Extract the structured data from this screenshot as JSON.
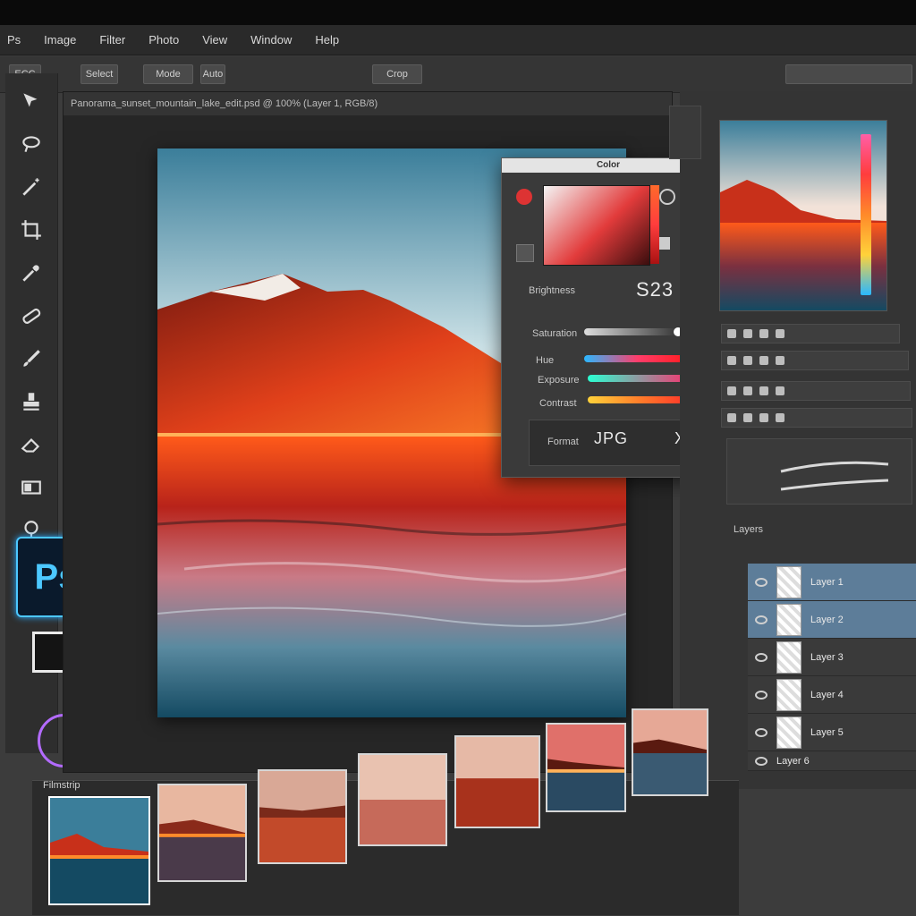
{
  "menu": {
    "items": [
      "Ps",
      "Image",
      "Filter",
      "Photo",
      "View",
      "Window",
      "Help"
    ]
  },
  "options_bar": {
    "buttons": [
      "ECC",
      "Select",
      "Mode",
      "Auto",
      "Crop"
    ]
  },
  "document": {
    "tab_title": "Panorama_sunset_mountain_lake_edit.psd @ 100% (Layer 1, RGB/8)"
  },
  "toolbar": {
    "app_badge": "Ps"
  },
  "color_panel": {
    "title": "Color",
    "value_label": "Brightness",
    "value": "S23",
    "rows": [
      "Saturation",
      "Hue",
      "Exposure",
      "Contrast"
    ],
    "format_label": "Format",
    "format_value": "JPG",
    "close_label": "X"
  },
  "layers": {
    "header": "Layers",
    "rows": [
      {
        "name": "Layer 1",
        "selected": true
      },
      {
        "name": "Layer 2",
        "selected": true
      },
      {
        "name": "Layer 3",
        "selected": false
      },
      {
        "name": "Layer 4",
        "selected": false
      },
      {
        "name": "Layer 5",
        "selected": false
      },
      {
        "name": "Layer 6",
        "selected": false
      }
    ]
  },
  "filmstrip": {
    "label": "Filmstrip"
  },
  "colors": {
    "accent": "#4cc8ff",
    "sunset_red": "#e43d1a"
  }
}
